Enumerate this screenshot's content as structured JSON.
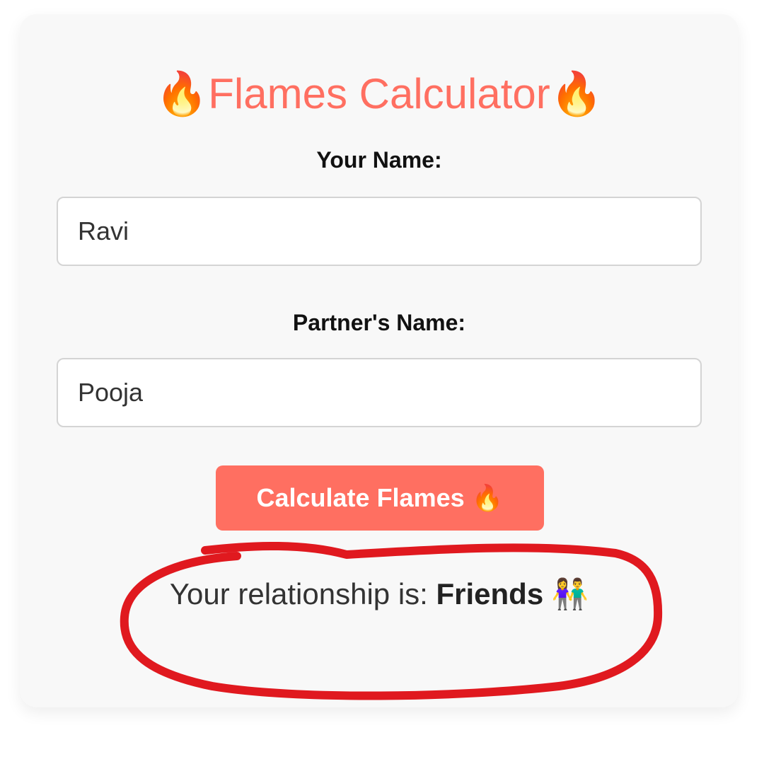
{
  "app": {
    "title": "Flames Calculator",
    "title_emoji": "🔥",
    "accent_color": "#ff6f61"
  },
  "form": {
    "your_name_label": "Your Name:",
    "your_name_value": "Ravi",
    "partner_name_label": "Partner's Name:",
    "partner_name_value": "Pooja",
    "submit_label": "Calculate Flames",
    "submit_emoji": "🔥"
  },
  "result": {
    "prefix": "Your relationship is:",
    "value": "Friends",
    "emoji": "👫"
  },
  "annotation": {
    "color": "#e0191f",
    "shape": "hand-drawn circle around result"
  }
}
